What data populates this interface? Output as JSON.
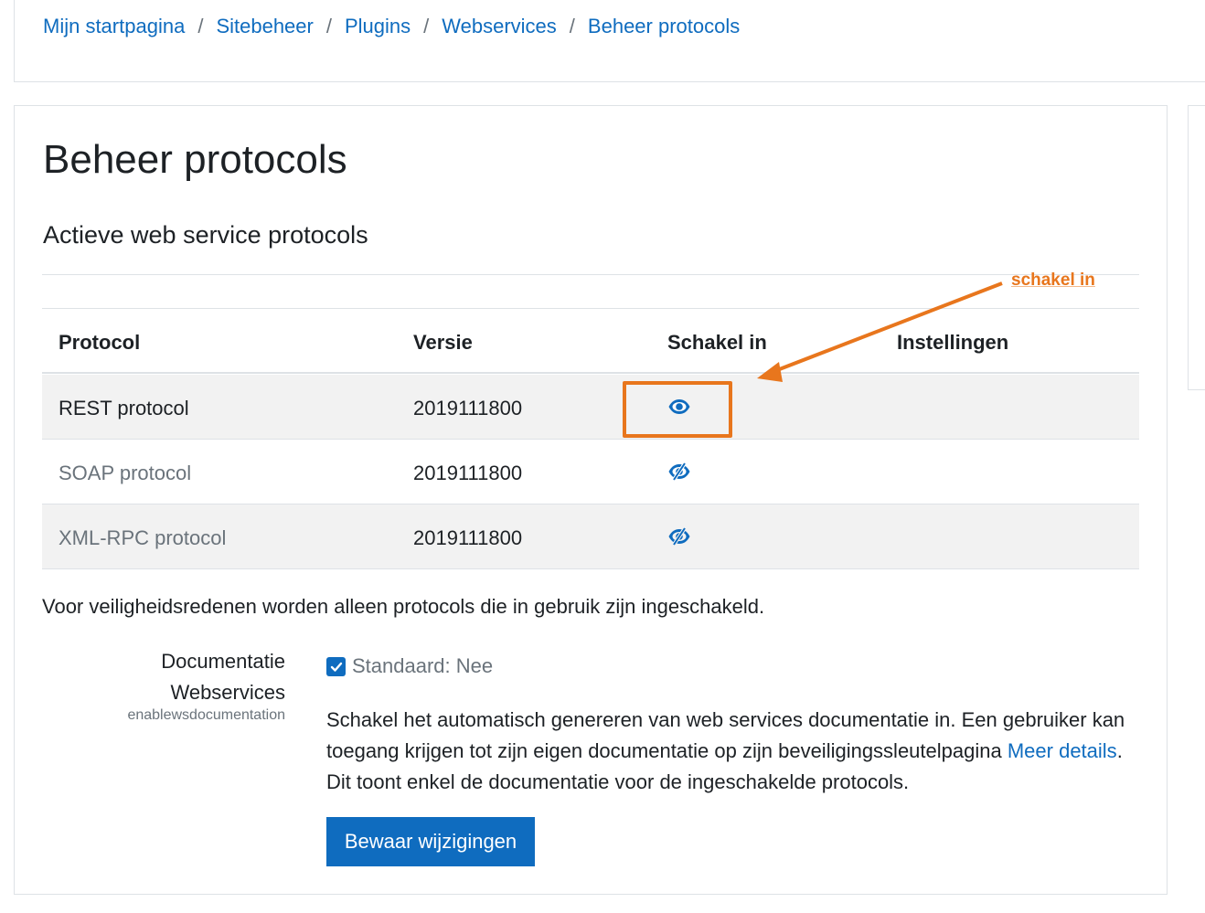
{
  "breadcrumb": [
    {
      "label": "Mijn startpagina"
    },
    {
      "label": "Sitebeheer"
    },
    {
      "label": "Plugins"
    },
    {
      "label": "Webservices"
    },
    {
      "label": "Beheer protocols"
    }
  ],
  "breadcrumb_separator": "/",
  "page_title": "Beheer protocols",
  "section_title": "Actieve web service protocols",
  "table": {
    "headers": {
      "protocol": "Protocol",
      "version": "Versie",
      "enable": "Schakel in",
      "settings": "Instellingen"
    },
    "rows": [
      {
        "protocol": "REST protocol",
        "version": "2019111800",
        "enabled": true,
        "icon": "eye-icon"
      },
      {
        "protocol": "SOAP protocol",
        "version": "2019111800",
        "enabled": false,
        "icon": "eye-slash-icon"
      },
      {
        "protocol": "XML-RPC protocol",
        "version": "2019111800",
        "enabled": false,
        "icon": "eye-slash-icon"
      }
    ]
  },
  "annotation": {
    "text": "schakel in",
    "color": "#e8761d"
  },
  "notice": "Voor veiligheidsredenen worden alleen protocols die in gebruik zijn ingeschakeld.",
  "setting": {
    "label_line1": "Documentatie",
    "label_line2": "Webservices",
    "name": "enablewsdocumentation",
    "checked": true,
    "default_label": "Standaard: Nee",
    "description_part1": "Schakel het automatisch genereren van web services documentatie in. Een gebruiker kan toegang krijgen tot zijn eigen documentatie op zijn beveiligingssleutelpagina ",
    "link_text": "Meer details",
    "description_part2": ". Dit toont enkel de documentatie voor de ingeschakelde protocols."
  },
  "save_button": "Bewaar wijzigingen",
  "colors": {
    "primary": "#0f6cbf",
    "annotation": "#e8761d",
    "stripe": "#f2f2f2",
    "border": "#dee2e6"
  }
}
